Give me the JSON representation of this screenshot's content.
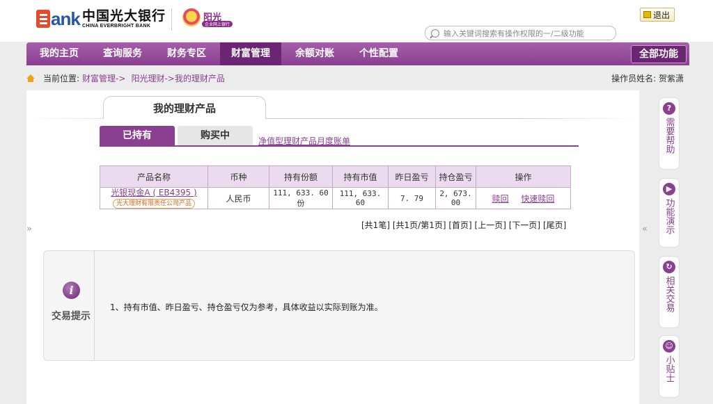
{
  "header": {
    "bank_name_cn": "中国光大银行",
    "bank_name_en": "CHINA EVERBRIGHT BANK",
    "logo_text": "ank",
    "service_title": "阳光",
    "service_subtitle": "企业网上银行",
    "exit_label": "退出",
    "search_placeholder": "输入关键词搜索有操作权限的一/二级功能"
  },
  "nav": {
    "items": [
      {
        "label": "我的主页"
      },
      {
        "label": "查询服务"
      },
      {
        "label": "财务专区"
      },
      {
        "label": "财富管理"
      },
      {
        "label": "余额对账"
      },
      {
        "label": "个性配置"
      }
    ],
    "active_index": 3,
    "all_functions": "全部功能"
  },
  "breadcrumb": {
    "prefix": "当前位置:",
    "path1": "财富管理->",
    "path2": "阳光理财->我的理财产品"
  },
  "operator": "操作员姓名: 贺紫潇",
  "section_title": "我的理财产品",
  "tabs": {
    "held": "已持有",
    "buying": "购买中",
    "monthly_bill_link": "净值型理财产品月度账单"
  },
  "table": {
    "headers": [
      "产品名称",
      "币种",
      "持有份额",
      "持有市值",
      "昨日盈亏",
      "持仓盈亏",
      "操作"
    ],
    "rows": [
      {
        "name": "光银现金A ( EB4395 )",
        "issuer": "光大理财有限责任公司产品",
        "currency": "人民币",
        "shares": "111, 633. 60份",
        "market_value": "111, 633. 60",
        "yesterday_pnl": "7. 79",
        "position_pnl": "2, 673. 00",
        "op1": "赎回",
        "op2": "快速赎回"
      }
    ]
  },
  "pager": {
    "total": "[共1笔]",
    "pages": "[共1页/第1页]",
    "first": "[首页]",
    "prev": "[上一页]",
    "next": "[下一页]",
    "last": "[尾页]"
  },
  "tip": {
    "title": "交易提示",
    "text": "1、持有市值、昨日盈亏、持仓盈亏仅为参考，具体收益以实际到账为准。"
  },
  "sidebar": {
    "items": [
      {
        "label": "需要帮助",
        "icon": "question-icon"
      },
      {
        "label": "功能演示",
        "icon": "play-icon"
      },
      {
        "label": "相关交易",
        "icon": "refresh-icon"
      },
      {
        "label": "小贴士",
        "icon": "smiley-icon"
      }
    ]
  },
  "colors": {
    "brand_purple": "#8a3f91",
    "brand_dark": "#6c2574",
    "table_header_bg": "#eadcee"
  }
}
